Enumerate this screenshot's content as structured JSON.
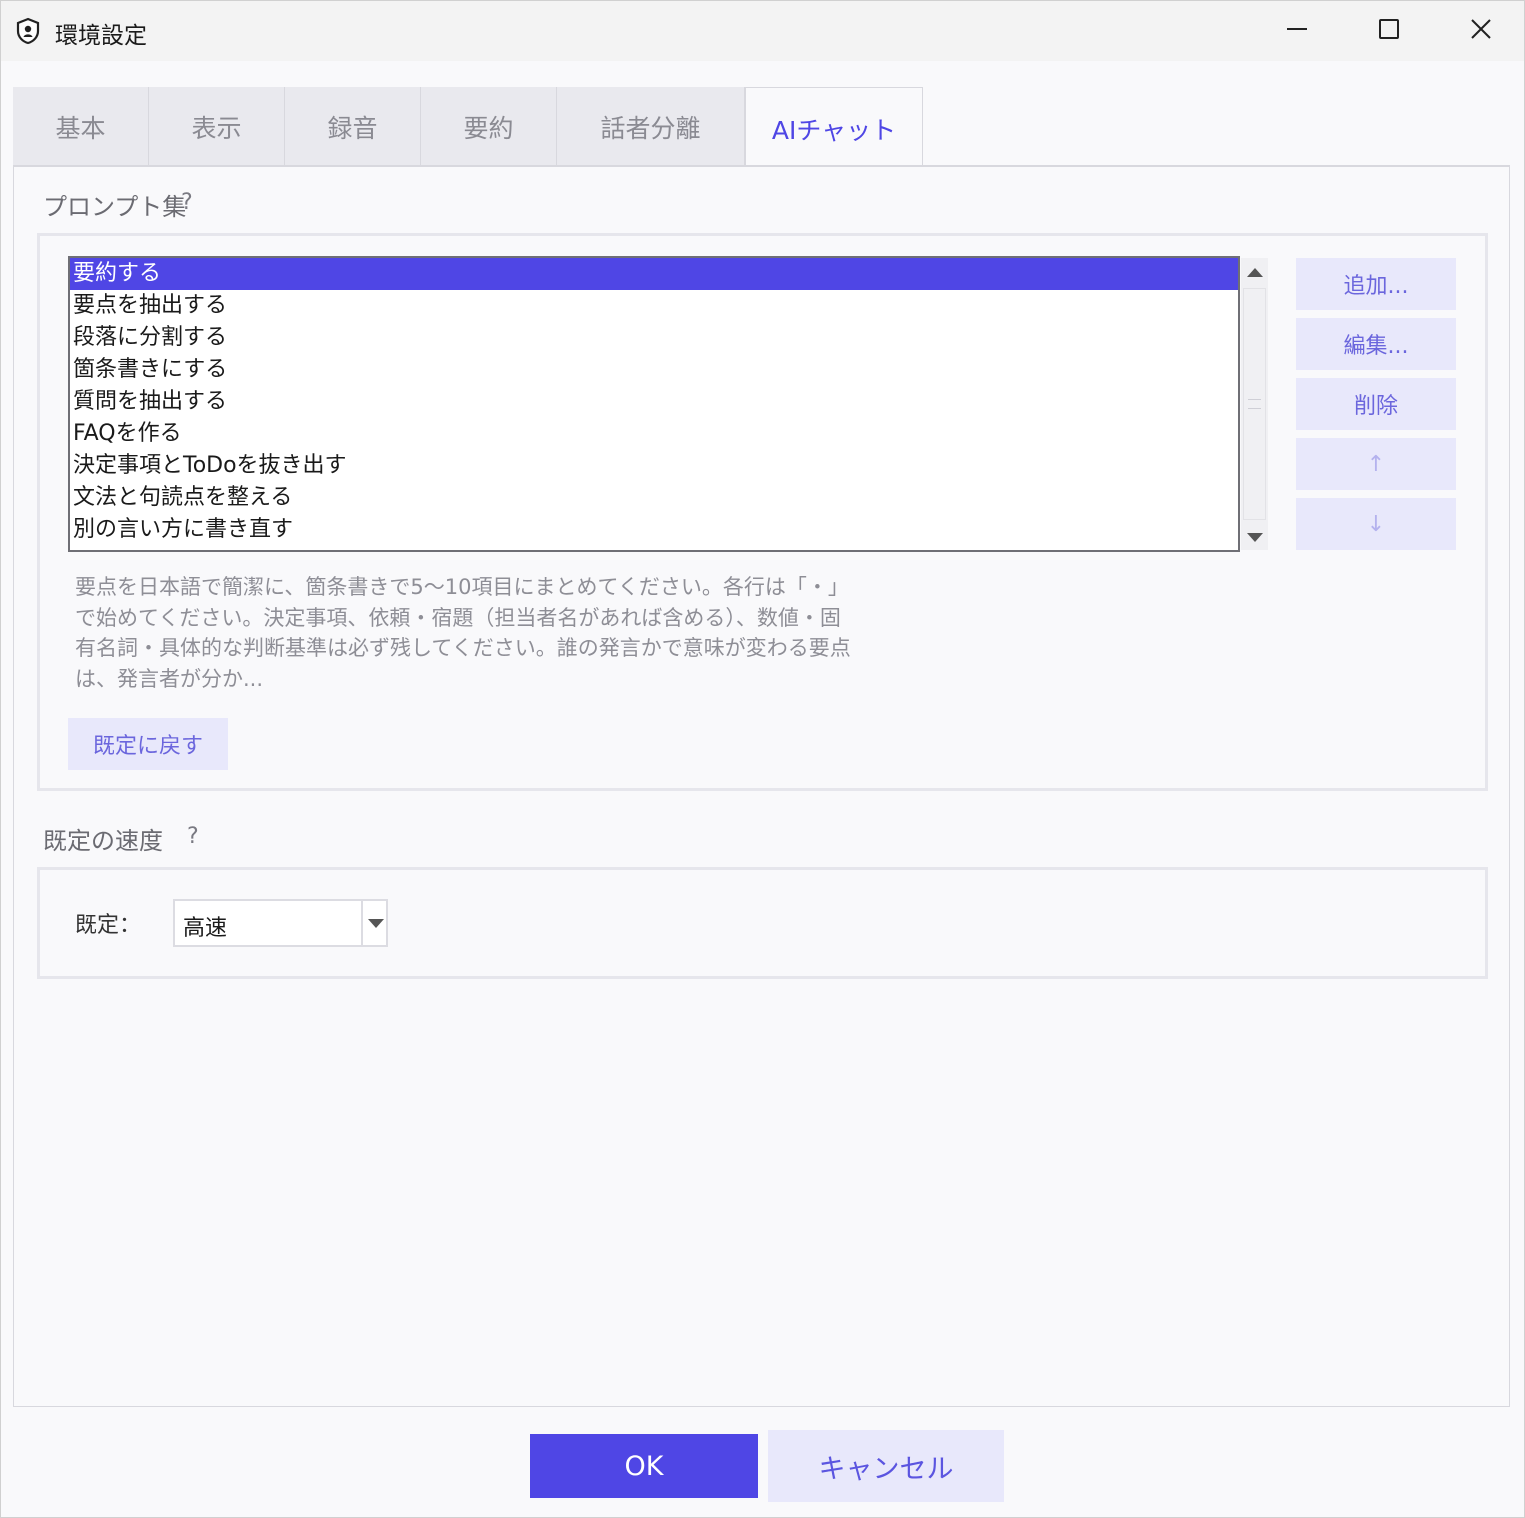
{
  "window": {
    "title": "環境設定",
    "icon": "shield-icon",
    "controls": {
      "minimize": "minimize-icon",
      "maximize": "maximize-icon",
      "close": "close-icon"
    }
  },
  "tabs": [
    {
      "label": "基本"
    },
    {
      "label": "表示"
    },
    {
      "label": "録音"
    },
    {
      "label": "要約"
    },
    {
      "label": "話者分離"
    },
    {
      "label": "AIチャット",
      "active": true
    }
  ],
  "prompts": {
    "title": "プロンプト集",
    "help": "?",
    "items": [
      "要約する",
      "要点を抽出する",
      "段落に分割する",
      "箇条書きにする",
      "質問を抽出する",
      "FAQを作る",
      "決定事項とToDoを抜き出す",
      "文法と句読点を整える",
      "別の言い方に書き直す"
    ],
    "selected_index": 0,
    "buttons": {
      "add": "追加...",
      "edit": "編集...",
      "delete": "削除",
      "up": "↑",
      "down": "↓"
    },
    "preview": "要点を日本語で簡潔に、箇条書きで5～10項目にまとめてください。各行は「・」で始めてください。決定事項、依頼・宿題（担当者名があれば含める）、数値・固有名詞・具体的な判断基準は必ず残してください。誰の発言かで意味が変わる要点は、発言者が分か...",
    "reset_label": "既定に戻す"
  },
  "speed": {
    "title": "既定の速度",
    "help": "?",
    "label": "既定：",
    "value": "高速"
  },
  "footer": {
    "ok": "OK",
    "cancel": "キャンセル"
  },
  "colors": {
    "accent": "#4f46e5",
    "button_bg": "#e8e8fb"
  }
}
